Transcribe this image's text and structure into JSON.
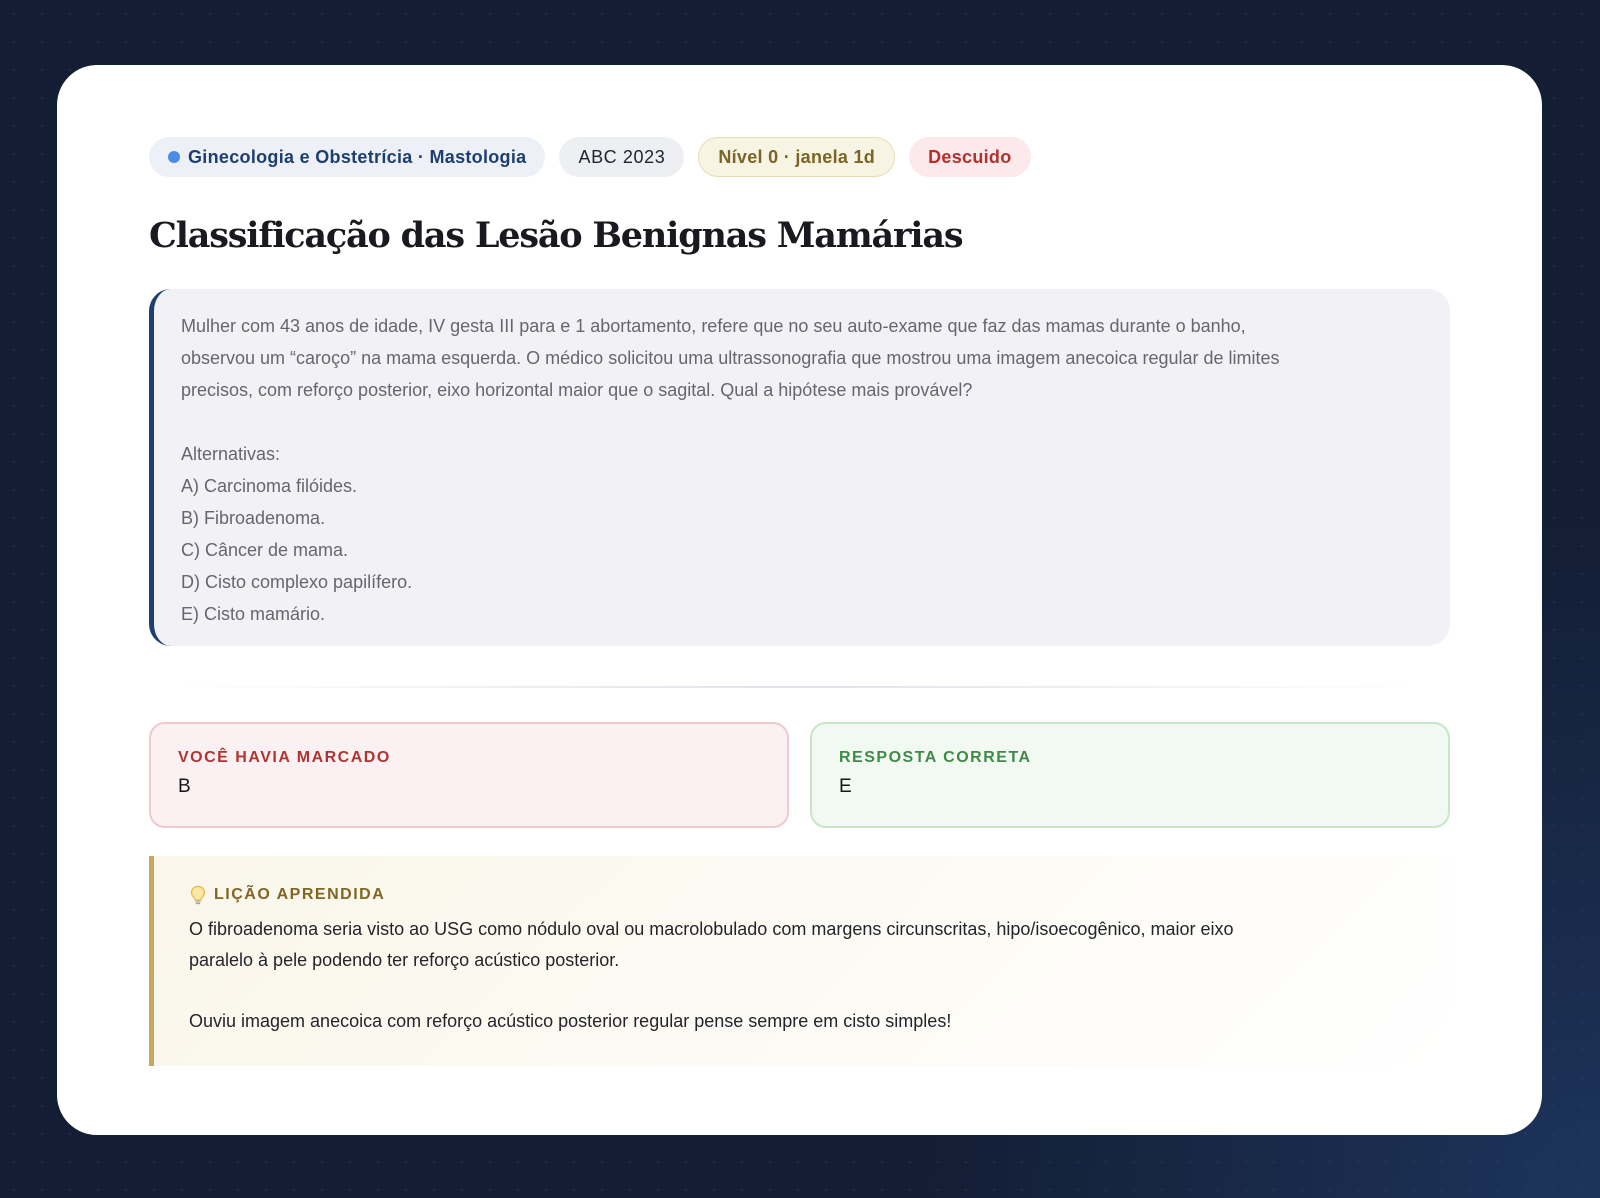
{
  "tags": {
    "topic": "Ginecologia e Obstetrícia · Mastologia",
    "exam": "ABC 2023",
    "level": "Nível 0 · janela 1d",
    "error_type": "Descuido"
  },
  "title": "Classificação das Lesão Benignas Mamárias",
  "question": {
    "stem_lines": [
      "Mulher com 43 anos de idade, IV gesta III para e 1 abortamento, refere que no seu auto-exame que faz das mamas durante o banho,",
      "observou um “caroço” na mama esquerda. O médico solicitou uma ultrassonografia que mostrou uma imagem anecoica regular de limites",
      "precisos, com reforço posterior, eixo horizontal maior que o sagital. Qual a hipótese mais provável?"
    ],
    "alternatives_label": "Alternativas:",
    "alternatives": [
      "A) Carcinoma filóides.",
      "B) Fibroadenoma.",
      "C) Câncer de mama.",
      "D) Cisto complexo papilífero.",
      "E) Cisto mamário."
    ]
  },
  "answers": {
    "marked_label": "VOCÊ HAVIA MARCADO",
    "marked_value": "B",
    "correct_label": "RESPOSTA CORRETA",
    "correct_value": "E"
  },
  "lesson": {
    "icon": "lightbulb-icon",
    "heading": "LIÇÃO APRENDIDA",
    "paragraph_1_line_1": "O fibroadenoma seria visto ao USG como nódulo oval ou macrolobulado com margens circunscritas, hipo/isoecogênico, maior eixo",
    "paragraph_1_line_2": "paralelo à pele podendo ter reforço acústico posterior.",
    "paragraph_2": "Ouviu imagem anecoica com reforço acústico posterior regular pense sempre em cisto simples!"
  },
  "colors": {
    "accent_navy": "#1f3f6e",
    "wrong_red": "#b03431",
    "correct_green": "#3f8a45",
    "lesson_gold": "#c9a75a"
  }
}
